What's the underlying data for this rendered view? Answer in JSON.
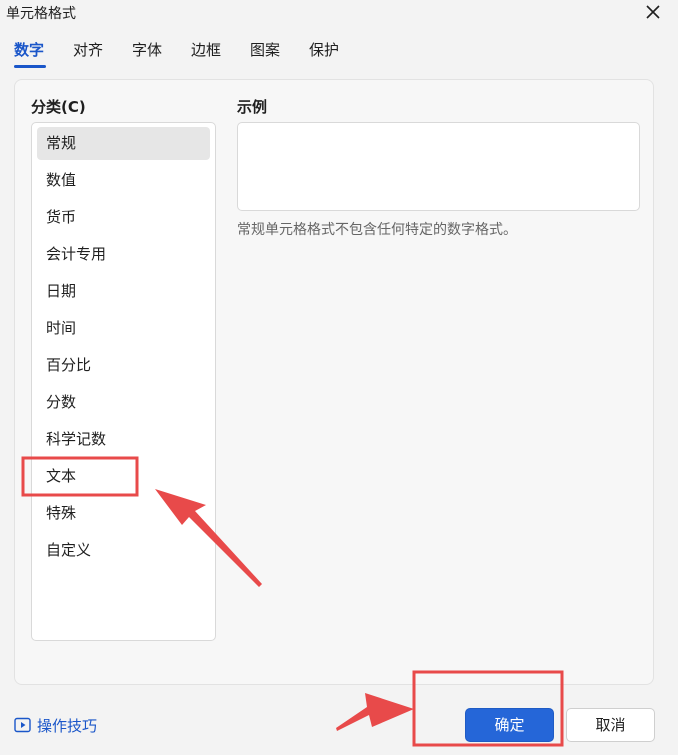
{
  "window": {
    "title": "单元格格式",
    "close_icon": "close-icon"
  },
  "tabs": [
    {
      "label": "数字",
      "active": true
    },
    {
      "label": "对齐",
      "active": false
    },
    {
      "label": "字体",
      "active": false
    },
    {
      "label": "边框",
      "active": false
    },
    {
      "label": "图案",
      "active": false
    },
    {
      "label": "保护",
      "active": false
    }
  ],
  "category": {
    "label": "分类(C)",
    "selected": "常规",
    "items": [
      "常规",
      "数值",
      "货币",
      "会计专用",
      "日期",
      "时间",
      "百分比",
      "分数",
      "科学记数",
      "文本",
      "特殊",
      "自定义"
    ]
  },
  "sample": {
    "label": "示例",
    "value": "",
    "description": "常规单元格格式不包含任何特定的数字格式。"
  },
  "footer": {
    "hint_icon": "play-box-icon",
    "hint_label": "操作技巧",
    "ok_label": "确定",
    "cancel_label": "取消"
  },
  "colors": {
    "accent": "#1a56c9",
    "primary_button": "#2566d8",
    "annotation_red": "#e84a4a"
  }
}
